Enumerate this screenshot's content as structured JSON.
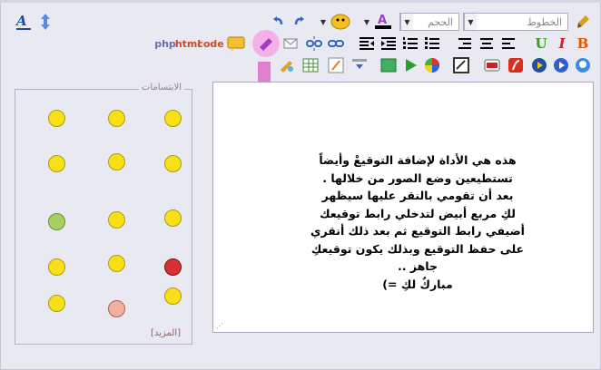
{
  "toolbar": {
    "font_select": "الخطوط",
    "size_select": "الحجم",
    "code_labels": {
      "php": "php",
      "html": "html",
      "code": "code"
    },
    "bold": "B",
    "italic": "I",
    "underline": "U",
    "font_a": "A"
  },
  "editor": {
    "message_lines": [
      "هذه هي الأداة لإضافة التوقيعْ وأيضاً",
      "تستطيعين وضع الصور من خلالها .",
      "بعد أن تقومي بالنقر عليها سيظهر",
      "لكِ مربع أبيض لتدخلي رابط توقيعك",
      "أضيفي رابط التوقيع ثم بعد ذلك أنقري",
      "على حفظ التوقيع وبذلك يكون توقيعكِ",
      "جاهز ..",
      "مباركٌ لكِ =)"
    ]
  },
  "smilies": {
    "title": "الابتسامات",
    "more": "[المزيد]"
  },
  "colors": {
    "arrow": "#e07ed0",
    "bold_orange": "#e05a00",
    "italic_red": "#d02020",
    "underline_green": "#3a9a1a"
  }
}
